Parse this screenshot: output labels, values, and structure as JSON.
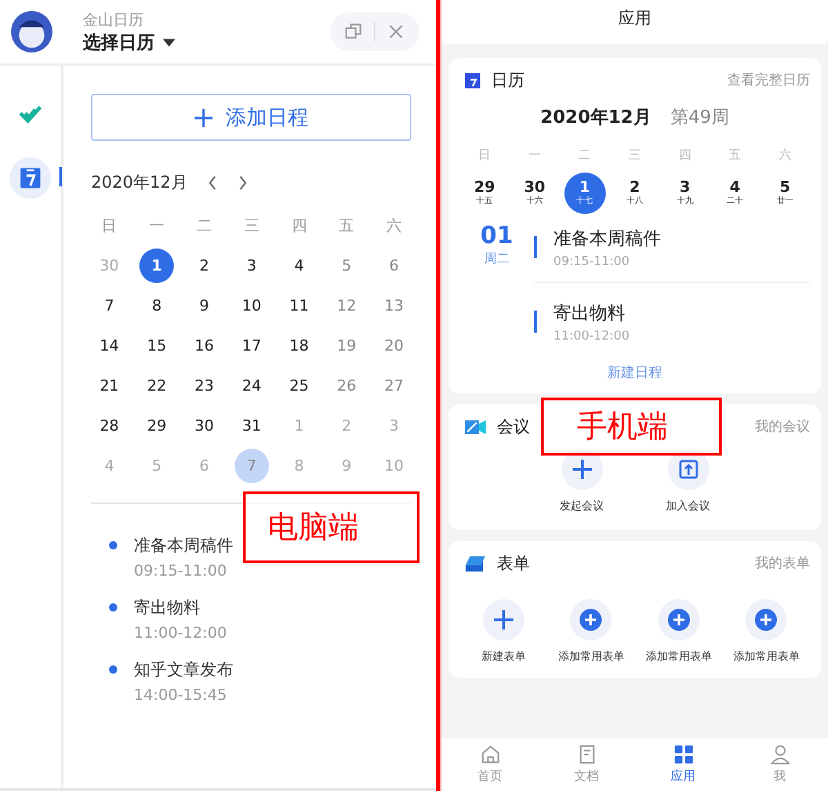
{
  "desktop": {
    "app_name": "金山日历",
    "calendar_picker": "选择日历",
    "sidebar": [
      {
        "kind": "check",
        "selected": false
      },
      {
        "kind": "calendar",
        "selected": true
      }
    ],
    "add_button": "添加日程",
    "month": "2020年12月",
    "weekdays": [
      "日",
      "一",
      "二",
      "三",
      "四",
      "五",
      "六"
    ],
    "days": [
      {
        "label": "30",
        "kind": "other"
      },
      {
        "label": "1",
        "kind": "today"
      },
      {
        "label": "2",
        "kind": "normal"
      },
      {
        "label": "3",
        "kind": "normal"
      },
      {
        "label": "4",
        "kind": "normal"
      },
      {
        "label": "5",
        "kind": "weekend"
      },
      {
        "label": "6",
        "kind": "weekend"
      },
      {
        "label": "7",
        "kind": "normal"
      },
      {
        "label": "8",
        "kind": "normal"
      },
      {
        "label": "9",
        "kind": "normal"
      },
      {
        "label": "10",
        "kind": "normal"
      },
      {
        "label": "11",
        "kind": "normal"
      },
      {
        "label": "12",
        "kind": "weekend"
      },
      {
        "label": "13",
        "kind": "weekend"
      },
      {
        "label": "14",
        "kind": "normal"
      },
      {
        "label": "15",
        "kind": "normal"
      },
      {
        "label": "16",
        "kind": "normal"
      },
      {
        "label": "17",
        "kind": "normal"
      },
      {
        "label": "18",
        "kind": "normal"
      },
      {
        "label": "19",
        "kind": "weekend"
      },
      {
        "label": "20",
        "kind": "weekend"
      },
      {
        "label": "21",
        "kind": "normal"
      },
      {
        "label": "22",
        "kind": "normal"
      },
      {
        "label": "23",
        "kind": "normal"
      },
      {
        "label": "24",
        "kind": "normal"
      },
      {
        "label": "25",
        "kind": "normal"
      },
      {
        "label": "26",
        "kind": "weekend"
      },
      {
        "label": "27",
        "kind": "weekend"
      },
      {
        "label": "28",
        "kind": "normal"
      },
      {
        "label": "29",
        "kind": "normal"
      },
      {
        "label": "30",
        "kind": "normal"
      },
      {
        "label": "31",
        "kind": "normal"
      },
      {
        "label": "1",
        "kind": "other"
      },
      {
        "label": "2",
        "kind": "other"
      },
      {
        "label": "3",
        "kind": "other"
      },
      {
        "label": "4",
        "kind": "other"
      },
      {
        "label": "5",
        "kind": "other"
      },
      {
        "label": "6",
        "kind": "other"
      },
      {
        "label": "7",
        "kind": "hover"
      },
      {
        "label": "8",
        "kind": "other"
      },
      {
        "label": "9",
        "kind": "other"
      },
      {
        "label": "10",
        "kind": "other"
      }
    ],
    "events": [
      {
        "title": "准备本周稿件",
        "time": "09:15-11:00"
      },
      {
        "title": "寄出物料",
        "time": "11:00-12:00"
      },
      {
        "title": "知乎文章发布",
        "time": "14:00-15:45"
      }
    ]
  },
  "mobile": {
    "title": "应用",
    "calendar": {
      "title": "日历",
      "link": "查看完整日历",
      "month": "2020年12月",
      "week": "第49周",
      "weekdays": [
        "日",
        "一",
        "二",
        "三",
        "四",
        "五",
        "六"
      ],
      "days": [
        {
          "day": "29",
          "lunar": "十五",
          "selected": false
        },
        {
          "day": "30",
          "lunar": "十六",
          "selected": false
        },
        {
          "day": "1",
          "lunar": "十七",
          "selected": true
        },
        {
          "day": "2",
          "lunar": "十八",
          "selected": false
        },
        {
          "day": "3",
          "lunar": "十九",
          "selected": false
        },
        {
          "day": "4",
          "lunar": "二十",
          "selected": false
        },
        {
          "day": "5",
          "lunar": "廿一",
          "selected": false
        }
      ],
      "date": "01",
      "weekday": "周二",
      "events": [
        {
          "title": "准备本周稿件",
          "time": "09:15-11:00"
        },
        {
          "title": "寄出物料",
          "time": "11:00-12:00"
        }
      ],
      "new_event": "新建日程"
    },
    "meeting": {
      "title": "会议",
      "link": "我的会议",
      "actions": [
        {
          "label": "发起会议",
          "kind": "plus"
        },
        {
          "label": "加入会议",
          "kind": "join"
        }
      ]
    },
    "forms": {
      "title": "表单",
      "link": "我的表单",
      "actions": [
        {
          "label": "新建表单",
          "kind": "plus"
        },
        {
          "label": "添加常用表单",
          "kind": "add"
        },
        {
          "label": "添加常用表单",
          "kind": "add"
        },
        {
          "label": "添加常用表单",
          "kind": "add"
        }
      ]
    },
    "tabs": [
      {
        "label": "首页",
        "kind": "home",
        "selected": false
      },
      {
        "label": "文档",
        "kind": "doc",
        "selected": false
      },
      {
        "label": "应用",
        "kind": "apps",
        "selected": true
      },
      {
        "label": "我",
        "kind": "me",
        "selected": false
      }
    ]
  },
  "annotations": [
    "电脑端",
    "手机端"
  ]
}
